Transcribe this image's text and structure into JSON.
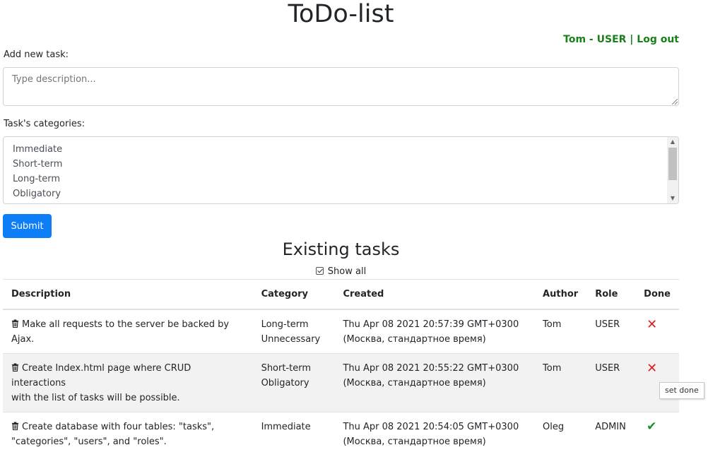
{
  "header": {
    "title": "ToDo-list",
    "user_label": "Tom - USER",
    "separator": "|",
    "logout_label": "Log out"
  },
  "form": {
    "new_task_label": "Add new task:",
    "description_placeholder": "Type description...",
    "categories_label": "Task's categories:",
    "categories": [
      "Immediate",
      "Short-term",
      "Long-term",
      "Obligatory"
    ],
    "submit_label": "Submit"
  },
  "tasks_section": {
    "title": "Existing tasks",
    "show_all_label": "Show all",
    "show_all_checked": true,
    "columns": {
      "description": "Description",
      "category": "Category",
      "created": "Created",
      "author": "Author",
      "role": "Role",
      "done": "Done"
    },
    "rows": [
      {
        "description": "Make all requests to the server be backed by Ajax.",
        "category_1": "Long-term",
        "category_2": "Unnecessary",
        "created_1": "Thu Apr 08 2021 20:57:39 GMT+0300",
        "created_2": "(Москва, стандартное время)",
        "author": "Tom",
        "role": "USER",
        "done_icon": "cross-icon",
        "done": false
      },
      {
        "description_1": "Create Index.html page where CRUD interactions",
        "description_2": "with the list of tasks will be possible.",
        "category_1": "Short-term",
        "category_2": "Obligatory",
        "created_1": "Thu Apr 08 2021 20:55:22 GMT+0300",
        "created_2": "(Москва, стандартное время)",
        "author": "Tom",
        "role": "USER",
        "done_icon": "cross-icon",
        "done": false
      },
      {
        "description_1": "Create database with four tables: \"tasks\",",
        "description_2": "\"categories\", \"users\", and \"roles\".",
        "category_1": "Immediate",
        "created_1": "Thu Apr 08 2021 20:54:05 GMT+0300",
        "created_2": "(Москва, стандартное время)",
        "author": "Oleg",
        "role": "ADMIN",
        "done_icon": "checkmark-icon",
        "done": true
      }
    ]
  },
  "tooltip": {
    "text": "set done"
  },
  "colors": {
    "accent": "#0d7ef8",
    "user_green": "#1a7f1a",
    "not_done_red": "#e0201a",
    "done_green": "#1a8f2a",
    "striped_row": "#f2f2f2"
  }
}
